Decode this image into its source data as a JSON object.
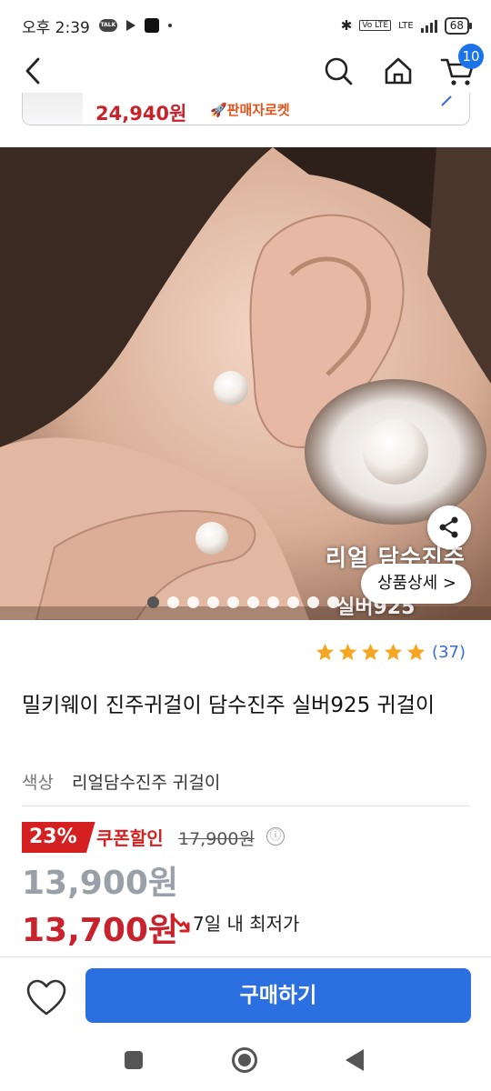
{
  "status_bar": {
    "time": "오후 2:39",
    "talk_badge": "TALK",
    "network": "LTE",
    "battery": "68"
  },
  "header": {
    "cart_count": "10"
  },
  "rocket_banner": {
    "price": "24,940원",
    "rocket_label": "🚀판매자로켓"
  },
  "product_image": {
    "overlay_text": "리얼 담수진주",
    "overlay_text2": "실버925",
    "detail_button": "상품상세 >",
    "slide_count": 10,
    "active_slide": 1
  },
  "rating": {
    "stars": 5,
    "count": "(37)",
    "star_color": "#f5a623"
  },
  "product": {
    "title": "밀키웨이 진주귀걸이 담수진주 실버925 귀걸이",
    "option_label": "색상",
    "option_value": "리얼담수진주 귀걸이"
  },
  "price": {
    "discount_rate": "23%",
    "coupon_label": "쿠폰할인",
    "original_price": "17,900원",
    "info_icon": "ⓘ",
    "sale_price": "13,900원",
    "coupon_price": "13,700원",
    "lowest_label": "7일 내 최저가",
    "accent_color": "#c8232c"
  },
  "bottom_bar": {
    "buy_label": "구매하기",
    "brand_color": "#2b6fe0"
  }
}
